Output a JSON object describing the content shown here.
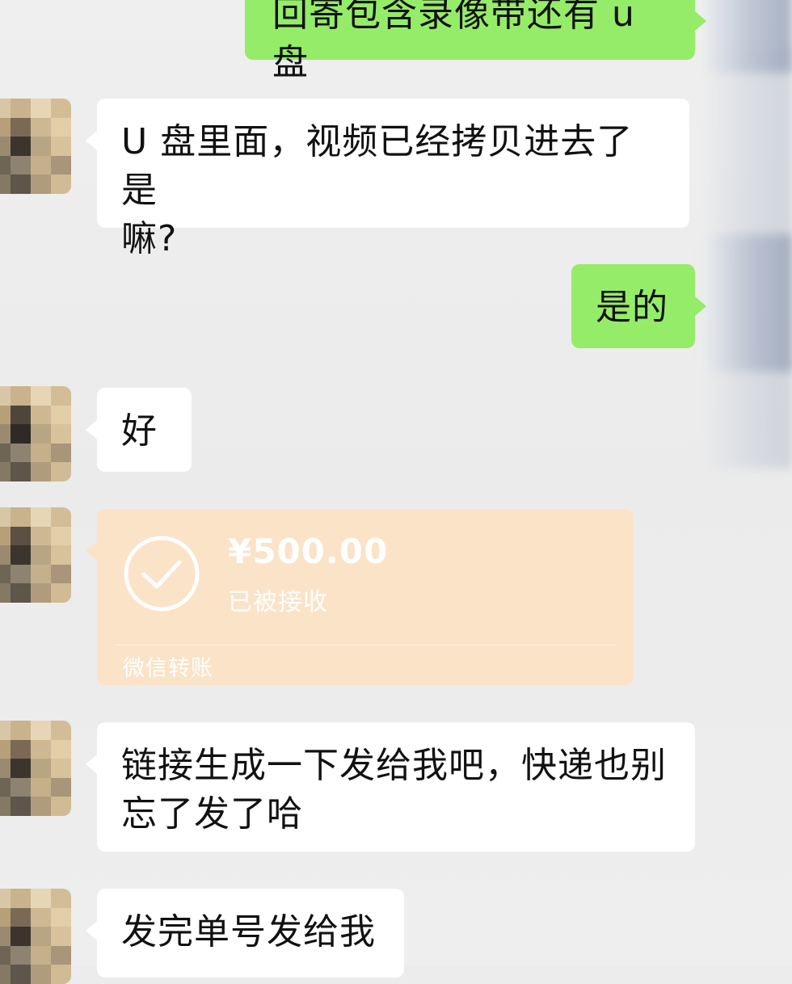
{
  "messages": [
    {
      "id": "m1",
      "side": "right",
      "text": "回寄包含录像带还有 u 盘"
    },
    {
      "id": "m2",
      "side": "left",
      "lines": [
        "U 盘里面，视频已经拷贝进去了是",
        "嘛?"
      ]
    },
    {
      "id": "m3",
      "side": "right",
      "text": "是的"
    },
    {
      "id": "m4",
      "side": "left",
      "text": "好"
    },
    {
      "id": "m6",
      "side": "left",
      "lines": [
        "链接生成一下发给我吧，快递也别",
        "忘了发了哈"
      ]
    },
    {
      "id": "m7",
      "side": "left",
      "text": "发完单号发给我"
    }
  ],
  "transfer": {
    "amount": "¥500.00",
    "status": "已被接收",
    "label": "微信转账",
    "icon": "check-circle-icon",
    "color": "#fbe3c7"
  },
  "colors": {
    "background": "#ececec",
    "sent_bubble": "#95ec69",
    "received_bubble": "#ffffff"
  }
}
